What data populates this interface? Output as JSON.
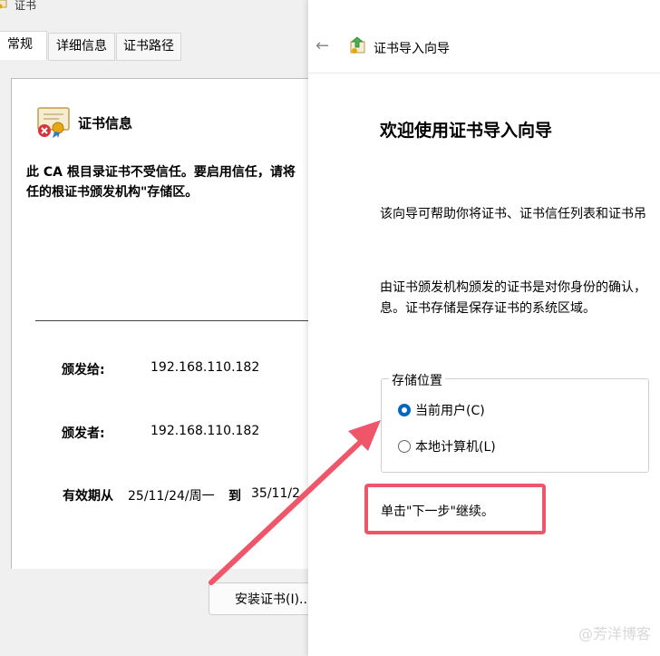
{
  "cert_window": {
    "title": "证书",
    "tabs": [
      "常规",
      "详细信息",
      "证书路径"
    ],
    "heading": "证书信息",
    "warning_line1": "此 CA 根目录证书不受信任。要启用信任，请将",
    "warning_line2": "任的根证书颁发机构\"存储区。",
    "issued_to_label": "颁发给:",
    "issued_to_value": "192.168.110.182",
    "issued_by_label": "颁发者:",
    "issued_by_value": "192.168.110.182",
    "validity_label": "有效期从",
    "validity_from": "25/11/24/周一",
    "validity_to_label": "到",
    "validity_to": "35/11/2",
    "install_button": "安装证书(I)..."
  },
  "wizard": {
    "title": "证书导入向导",
    "heading": "欢迎使用证书导入向导",
    "desc1": "该向导可帮助你将证书、证书信任列表和证书吊",
    "desc2_line1": "由证书颁发机构颁发的证书是对你身份的确认，",
    "desc2_line2": "息。证书存储是保存证书的系统区域。",
    "store_location_label": "存储位置",
    "options": [
      "当前用户(C)",
      "本地计算机(L)"
    ],
    "selected_option": "当前用户(C)",
    "continue_text": "单击\"下一步\"继续。"
  },
  "watermark": "@芳洋博客",
  "colors": {
    "accent": "#0067c0",
    "highlight": "#f0566a"
  },
  "icons": {
    "title": "certificate-icon",
    "back": "back-arrow-icon",
    "wizard": "certificate-import-icon"
  }
}
